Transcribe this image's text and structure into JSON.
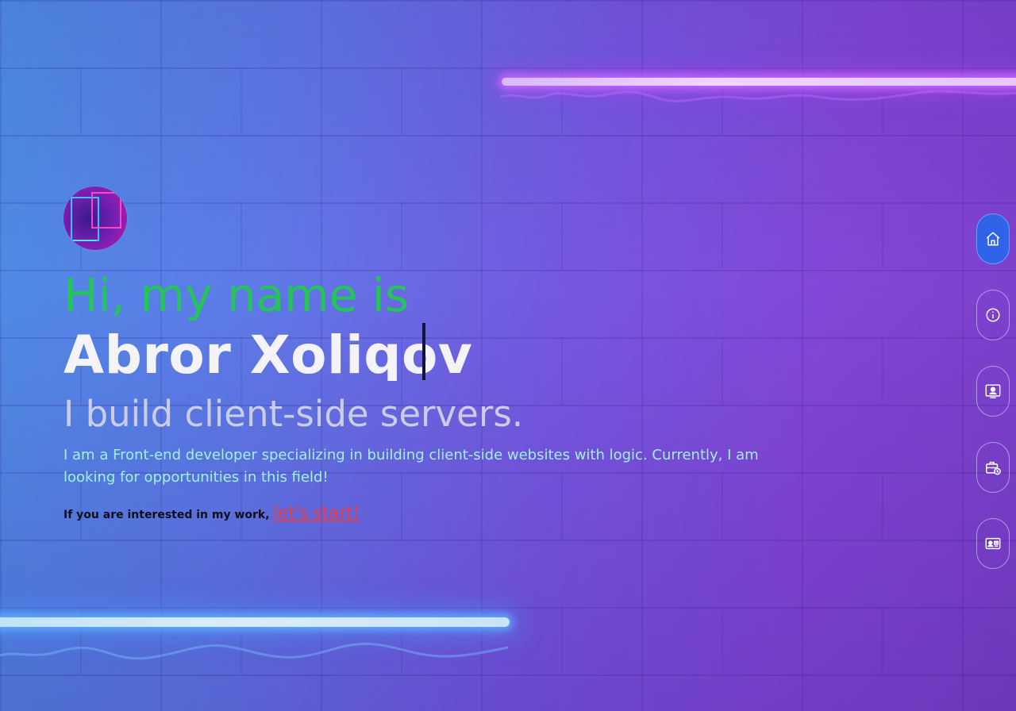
{
  "hero": {
    "greeting": "Hi, my name is",
    "name": "Abror Xoliqov",
    "tagline": "I build client-side servers.",
    "intro": "I am a Front-end developer specializing in building client-side websites with logic. Currently, I am looking for opportunities in this field!",
    "cta_text": "If you are interested in my work, ",
    "cta_link": "let's start!"
  },
  "sidenav": {
    "items": [
      {
        "icon": "home-icon",
        "active": true
      },
      {
        "icon": "info-icon",
        "active": false
      },
      {
        "icon": "user-profile-icon",
        "active": false
      },
      {
        "icon": "briefcase-clock-icon",
        "active": false
      },
      {
        "icon": "contact-card-icon",
        "active": false
      }
    ]
  },
  "colors": {
    "greeting": "#25c45a",
    "name": "#f3f3f8",
    "tagline": "#c9cde8",
    "intro": "#9ff0e6",
    "link": "#ef3b46",
    "nav_active": "#2f63e8"
  }
}
